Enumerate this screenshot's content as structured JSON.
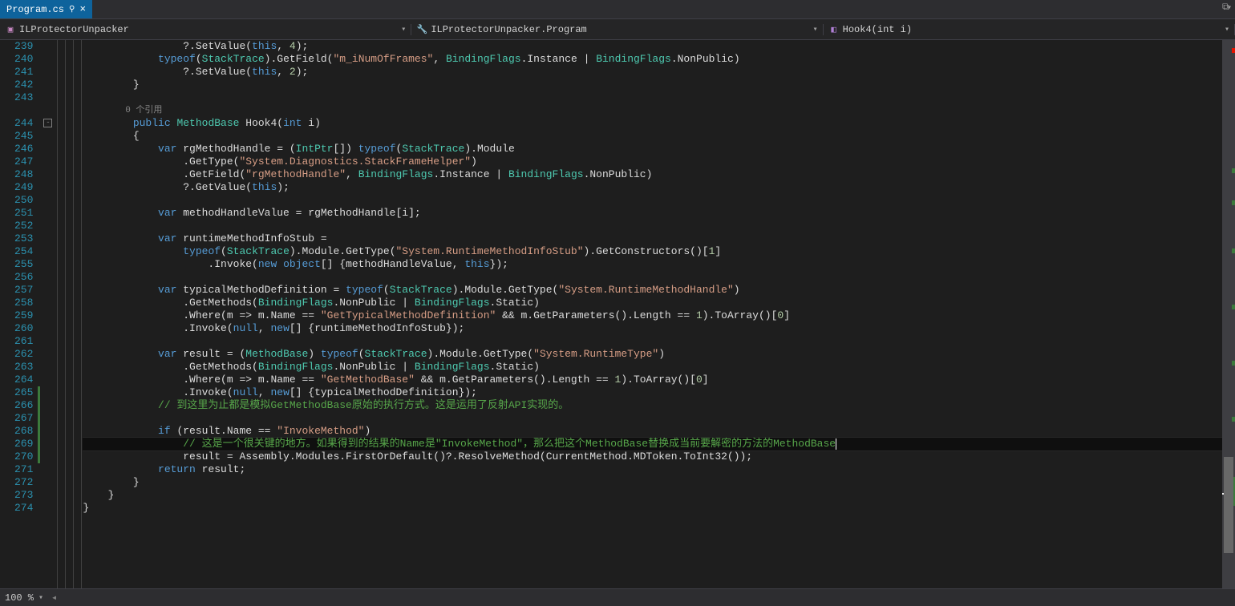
{
  "tab": {
    "title": "Program.cs"
  },
  "breadcrumb": {
    "scope1": "ILProtectorUnpacker",
    "scope2": "ILProtectorUnpacker.Program",
    "scope3": "Hook4(int i)"
  },
  "codelens": "0 个引用",
  "status": {
    "zoom": "100 %"
  },
  "lines": [
    {
      "n": 239,
      "html": "                ?.SetValue(<span class='tok-kw'>this</span>, <span class='tok-num'>4</span>);"
    },
    {
      "n": 240,
      "html": "            <span class='tok-kw'>typeof</span>(<span class='tok-type'>StackTrace</span>).GetField(<span class='tok-str'>\"m_iNumOfFrames\"</span>, <span class='tok-type'>BindingFlags</span>.Instance | <span class='tok-type'>BindingFlags</span>.NonPublic)"
    },
    {
      "n": 241,
      "html": "                ?.SetValue(<span class='tok-kw'>this</span>, <span class='tok-num'>2</span>);"
    },
    {
      "n": 242,
      "html": "        }"
    },
    {
      "n": 243,
      "html": ""
    },
    {
      "n": 0,
      "lens": true
    },
    {
      "n": 244,
      "html": "        <span class='tok-kw'>public</span> <span class='tok-type'>MethodBase</span> Hook4(<span class='tok-kw'>int</span> i)",
      "fold": true
    },
    {
      "n": 245,
      "html": "        {"
    },
    {
      "n": 246,
      "html": "            <span class='tok-kw'>var</span> rgMethodHandle = (<span class='tok-type'>IntPtr</span>[]) <span class='tok-kw'>typeof</span>(<span class='tok-type'>StackTrace</span>).Module"
    },
    {
      "n": 247,
      "html": "                .GetType(<span class='tok-str'>\"System.Diagnostics.StackFrameHelper\"</span>)"
    },
    {
      "n": 248,
      "html": "                .GetField(<span class='tok-str'>\"rgMethodHandle\"</span>, <span class='tok-type'>BindingFlags</span>.Instance | <span class='tok-type'>BindingFlags</span>.NonPublic)"
    },
    {
      "n": 249,
      "html": "                ?.GetValue(<span class='tok-kw'>this</span>);"
    },
    {
      "n": 250,
      "html": ""
    },
    {
      "n": 251,
      "html": "            <span class='tok-kw'>var</span> methodHandleValue = rgMethodHandle[i];"
    },
    {
      "n": 252,
      "html": ""
    },
    {
      "n": 253,
      "html": "            <span class='tok-kw'>var</span> runtimeMethodInfoStub ="
    },
    {
      "n": 254,
      "html": "                <span class='tok-kw'>typeof</span>(<span class='tok-type'>StackTrace</span>).Module.GetType(<span class='tok-str'>\"System.RuntimeMethodInfoStub\"</span>).GetConstructors()[<span class='tok-num'>1</span>]"
    },
    {
      "n": 255,
      "html": "                    .Invoke(<span class='tok-kw'>new</span> <span class='tok-kw'>object</span>[] {methodHandleValue, <span class='tok-kw'>this</span>});"
    },
    {
      "n": 256,
      "html": ""
    },
    {
      "n": 257,
      "html": "            <span class='tok-kw'>var</span> typicalMethodDefinition = <span class='tok-kw'>typeof</span>(<span class='tok-type'>StackTrace</span>).Module.GetType(<span class='tok-str'>\"System.RuntimeMethodHandle\"</span>)"
    },
    {
      "n": 258,
      "html": "                .GetMethods(<span class='tok-type'>BindingFlags</span>.NonPublic | <span class='tok-type'>BindingFlags</span>.Static)"
    },
    {
      "n": 259,
      "html": "                .Where(m => m.Name == <span class='tok-str'>\"GetTypicalMethodDefinition\"</span> &amp;&amp; m.GetParameters().Length == <span class='tok-num'>1</span>).ToArray()[<span class='tok-num'>0</span>]"
    },
    {
      "n": 260,
      "html": "                .Invoke(<span class='tok-kw'>null</span>, <span class='tok-kw'>new</span>[] {runtimeMethodInfoStub});"
    },
    {
      "n": 261,
      "html": ""
    },
    {
      "n": 262,
      "html": "            <span class='tok-kw'>var</span> result = (<span class='tok-type'>MethodBase</span>) <span class='tok-kw'>typeof</span>(<span class='tok-type'>StackTrace</span>).Module.GetType(<span class='tok-str'>\"System.RuntimeType\"</span>)"
    },
    {
      "n": 263,
      "html": "                .GetMethods(<span class='tok-type'>BindingFlags</span>.NonPublic | <span class='tok-type'>BindingFlags</span>.Static)"
    },
    {
      "n": 264,
      "html": "                .Where(m => m.Name == <span class='tok-str'>\"GetMethodBase\"</span> &amp;&amp; m.GetParameters().Length == <span class='tok-num'>1</span>).ToArray()[<span class='tok-num'>0</span>]"
    },
    {
      "n": 265,
      "html": "                .Invoke(<span class='tok-kw'>null</span>, <span class='tok-kw'>new</span>[] {typicalMethodDefinition});",
      "mark": true
    },
    {
      "n": 266,
      "html": "            <span class='tok-com'>// 到这里为止都是模拟GetMethodBase原始的执行方式。这是运用了反射API实现的。</span>",
      "mark": true
    },
    {
      "n": 267,
      "html": "",
      "mark": true
    },
    {
      "n": 268,
      "html": "            <span class='tok-kw'>if</span> (result.Name == <span class='tok-str'>\"InvokeMethod\"</span>)",
      "mark": true
    },
    {
      "n": 269,
      "html": "                <span class='tok-com'>// 这是一个很关键的地方。如果得到的结果的Name是\"InvokeMethod\"，那么把这个MethodBase替换成当前要解密的方法的MethodBase</span><span class='caret-ind'></span>",
      "cursor": true,
      "mark": true
    },
    {
      "n": 270,
      "html": "                result = Assembly.Modules.FirstOrDefault()?.ResolveMethod(CurrentMethod.MDToken.ToInt32());",
      "mark": true
    },
    {
      "n": 271,
      "html": "            <span class='tok-kw'>return</span> result;"
    },
    {
      "n": 272,
      "html": "        }"
    },
    {
      "n": 273,
      "html": "    }"
    },
    {
      "n": 274,
      "html": "}"
    }
  ]
}
